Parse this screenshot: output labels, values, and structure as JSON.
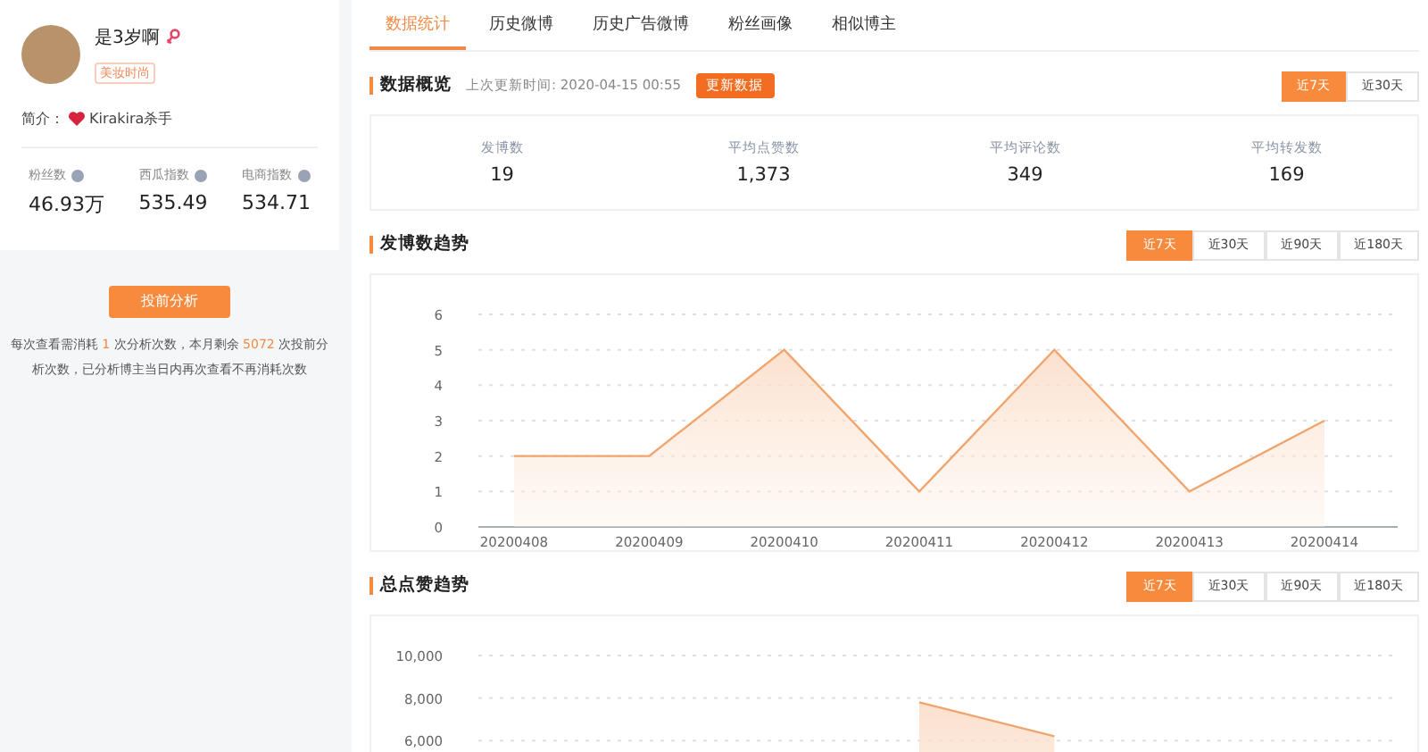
{
  "profile": {
    "name": "是3岁啊",
    "tag": "美妆时尚",
    "bio_label": "简介：",
    "bio": "Kirakira杀手",
    "stats": [
      {
        "label": "粉丝数",
        "value": "46.93万"
      },
      {
        "label": "西瓜指数",
        "value": "535.49"
      },
      {
        "label": "电商指数",
        "value": "534.71"
      }
    ]
  },
  "analyze_button": "投前分析",
  "notice": {
    "before": "每次查看需消耗",
    "count": "1",
    "middle": "次分析次数，本月剩余",
    "remaining": "5072",
    "after": "次投前分析次数，已分析博主当日内再次查看不再消耗次数"
  },
  "tabs": [
    {
      "label": "数据统计",
      "selected": true
    },
    {
      "label": "历史微博",
      "selected": false
    },
    {
      "label": "历史广告微博",
      "selected": false
    },
    {
      "label": "粉丝画像",
      "selected": false
    },
    {
      "label": "相似博主",
      "selected": false
    }
  ],
  "overview": {
    "title": "数据概览",
    "updated": "上次更新时间: 2020-04-15 00:55",
    "refresh_button": "更新数据",
    "ranges": [
      {
        "label": "近7天",
        "selected": true
      },
      {
        "label": "近30天",
        "selected": false
      }
    ],
    "metrics": [
      {
        "label": "发博数",
        "value": "19"
      },
      {
        "label": "平均点赞数",
        "value": "1,373"
      },
      {
        "label": "平均评论数",
        "value": "349"
      },
      {
        "label": "平均转发数",
        "value": "169"
      }
    ]
  },
  "trends": [
    {
      "title": "发博数趋势",
      "ranges": [
        {
          "label": "近7天",
          "selected": true
        },
        {
          "label": "近30天",
          "selected": false
        },
        {
          "label": "近90天",
          "selected": false
        },
        {
          "label": "近180天",
          "selected": false
        }
      ],
      "chart_data": {
        "type": "area",
        "categories": [
          "20200408",
          "20200409",
          "20200410",
          "20200411",
          "20200412",
          "20200413",
          "20200414"
        ],
        "series": [
          {
            "color": "#f0a56e",
            "values": [
              2,
              2,
              5,
              1,
              5,
              1,
              3
            ]
          }
        ],
        "ylim": [
          0,
          6
        ],
        "yticks": [
          0,
          1,
          2,
          3,
          4,
          5,
          6
        ],
        "grid": true
      }
    },
    {
      "title": "总点赞趋势",
      "ranges": [
        {
          "label": "近7天",
          "selected": true
        },
        {
          "label": "近30天",
          "selected": false
        },
        {
          "label": "近90天",
          "selected": false
        },
        {
          "label": "近180天",
          "selected": false
        }
      ],
      "chart_data": {
        "type": "area",
        "series": [
          {
            "color": "#f0a56e",
            "values": [
              null,
              null,
              null,
              7800,
              6200,
              null,
              null
            ]
          }
        ],
        "ylim": [
          6000,
          10000
        ],
        "grid": true,
        "yticks": [
          {
            "value": 6000,
            "label": "6,000"
          },
          {
            "value": 8000,
            "label": "8,000"
          },
          {
            "value": 10000,
            "label": "10,000"
          }
        ]
      }
    }
  ]
}
